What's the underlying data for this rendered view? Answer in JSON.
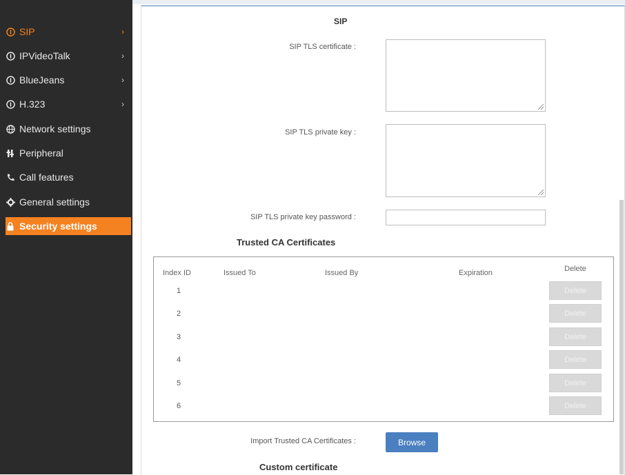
{
  "sidebar": {
    "items": [
      {
        "label": "SIP",
        "icon": "circle-number-icon",
        "chevron": "›"
      },
      {
        "label": "IPVideoTalk",
        "icon": "circle-number-icon",
        "chevron": "›"
      },
      {
        "label": "BlueJeans",
        "icon": "circle-number-icon",
        "chevron": "›"
      },
      {
        "label": "H.323",
        "icon": "circle-number-icon",
        "chevron": "›"
      },
      {
        "label": "Network settings",
        "icon": "globe-icon"
      },
      {
        "label": "Peripheral",
        "icon": "peripheral-icon"
      },
      {
        "label": "Call features",
        "icon": "phone-icon"
      },
      {
        "label": "General settings",
        "icon": "gear-icon"
      },
      {
        "label": "Security settings",
        "icon": "lock-icon"
      }
    ]
  },
  "main": {
    "section_title": "SIP",
    "fields": {
      "tls_certificate_label": "SIP TLS certificate :",
      "tls_private_key_label": "SIP TLS private key :",
      "tls_private_key_password_label": "SIP TLS private key password :",
      "tls_certificate_value": "",
      "tls_private_key_value": "",
      "tls_private_key_password_value": ""
    },
    "trusted_ca": {
      "title": "Trusted CA Certificates",
      "columns": [
        "Index ID",
        "Issued To",
        "Issued By",
        "Expiration",
        "Delete"
      ],
      "rows": [
        {
          "index": "1",
          "delete_label": "Delete"
        },
        {
          "index": "2",
          "delete_label": "Delete"
        },
        {
          "index": "3",
          "delete_label": "Delete"
        },
        {
          "index": "4",
          "delete_label": "Delete"
        },
        {
          "index": "5",
          "delete_label": "Delete"
        },
        {
          "index": "6",
          "delete_label": "Delete"
        }
      ],
      "import_label": "Import Trusted CA Certificates :",
      "browse_label": "Browse"
    },
    "custom_certificate_title": "Custom certificate"
  },
  "colors": {
    "accent": "#f58220",
    "sidebar_bg": "#2b2b2b",
    "button_blue": "#4a7fc0",
    "disabled_button": "#d9d9d9"
  }
}
